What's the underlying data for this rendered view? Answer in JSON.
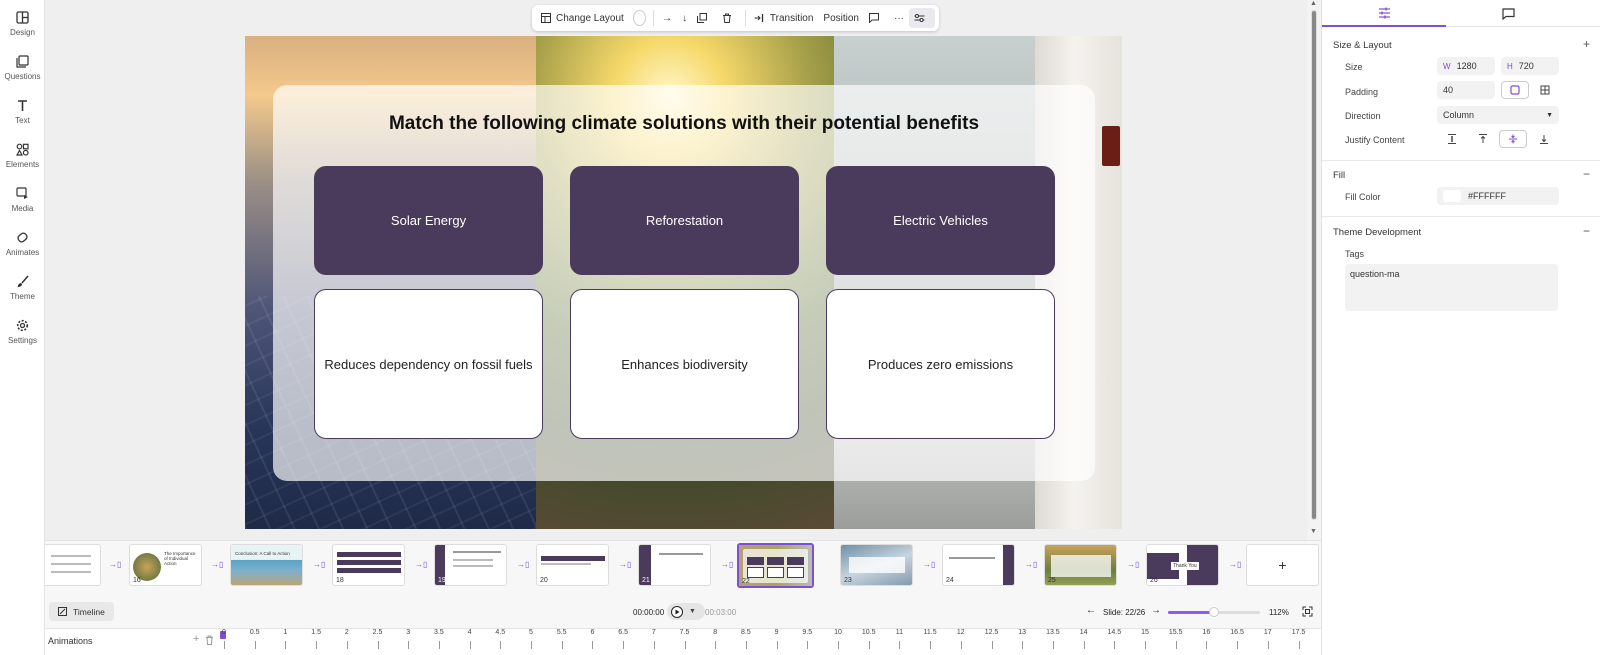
{
  "sidebar": {
    "items": [
      {
        "label": "Design",
        "icon": "layout-icon"
      },
      {
        "label": "Questions",
        "icon": "questions-icon"
      },
      {
        "label": "Text",
        "icon": "text-icon"
      },
      {
        "label": "Elements",
        "icon": "elements-icon"
      },
      {
        "label": "Media",
        "icon": "media-icon"
      },
      {
        "label": "Animates",
        "icon": "animates-icon"
      },
      {
        "label": "Theme",
        "icon": "brush-icon"
      },
      {
        "label": "Settings",
        "icon": "gear-icon"
      }
    ]
  },
  "toolbar": {
    "change_layout": "Change Layout",
    "transition": "Transition",
    "position": "Position"
  },
  "slide": {
    "title": "Match the following climate solutions with their potential benefits",
    "solutions": [
      "Solar Energy",
      "Reforestation",
      "Electric Vehicles"
    ],
    "benefits": [
      "Reduces dependency on fossil fuels",
      "Enhances biodiversity",
      "Produces zero emissions"
    ],
    "accent_color": "#4a3a5c"
  },
  "right_panel": {
    "size_layout": {
      "heading": "Size & Layout",
      "size_label": "Size",
      "width_prefix": "W",
      "width": "1280",
      "height_prefix": "H",
      "height": "720",
      "padding_label": "Padding",
      "padding": "40",
      "direction_label": "Direction",
      "direction": "Column",
      "justify_label": "Justify Content"
    },
    "fill": {
      "heading": "Fill",
      "color_label": "Fill Color",
      "color": "#FFFFFF"
    },
    "theme_dev": {
      "heading": "Theme Development",
      "tags_label": "Tags",
      "tags_value": "question-ma"
    }
  },
  "filmstrip": {
    "slide_numbers": [
      "16",
      "18",
      "19",
      "20",
      "21",
      "22",
      "23",
      "24",
      "25",
      "26"
    ],
    "thumb_texts": {
      "t16": "The Importance of Individual Action",
      "t17": "Conclusion: A Call to Action",
      "t26": "Thank You"
    }
  },
  "playback": {
    "timeline_label": "Timeline",
    "current_time": "00:00:00",
    "total_time": "00:03:00",
    "slide_indicator": "Slide: 22/26",
    "zoom": "112%",
    "zoom_level": 0.5
  },
  "animations": {
    "label": "Animations",
    "ruler_ticks": [
      "0",
      "0.5",
      "1",
      "1.5",
      "2",
      "2.5",
      "3",
      "3.5",
      "4",
      "4.5",
      "5",
      "5.5",
      "6",
      "6.5",
      "7",
      "7.5",
      "8",
      "8.5",
      "9",
      "9.5",
      "10",
      "10.5",
      "11",
      "11.5",
      "12",
      "12.5",
      "13",
      "13.5",
      "14",
      "14.5",
      "15",
      "15.5",
      "16",
      "16.5",
      "17",
      "17.5"
    ]
  }
}
